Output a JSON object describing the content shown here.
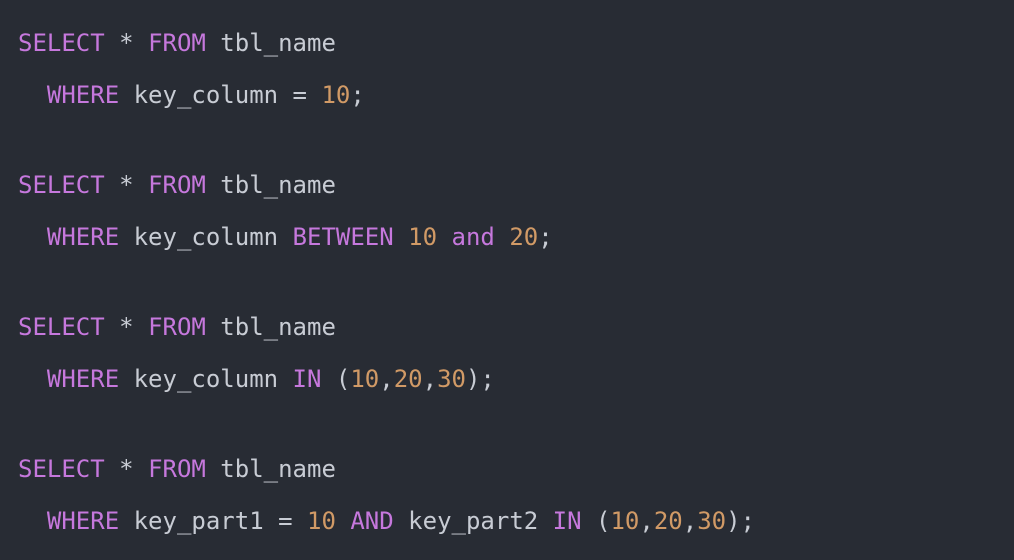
{
  "editor": {
    "background": "#282c34",
    "colors": {
      "keyword": "#c678dd",
      "number": "#d19a66",
      "plain": "#c8ccd4"
    },
    "lines": [
      [
        {
          "t": "keyword",
          "v": "SELECT"
        },
        {
          "t": "plain",
          "v": " * "
        },
        {
          "t": "keyword",
          "v": "FROM"
        },
        {
          "t": "plain",
          "v": " tbl_name"
        }
      ],
      [
        {
          "t": "plain",
          "v": "  "
        },
        {
          "t": "keyword",
          "v": "WHERE"
        },
        {
          "t": "plain",
          "v": " key_column = "
        },
        {
          "t": "number",
          "v": "10"
        },
        {
          "t": "punct",
          "v": ";"
        }
      ],
      [
        {
          "t": "keyword",
          "v": "SELECT"
        },
        {
          "t": "plain",
          "v": " * "
        },
        {
          "t": "keyword",
          "v": "FROM"
        },
        {
          "t": "plain",
          "v": " tbl_name"
        }
      ],
      [
        {
          "t": "plain",
          "v": "  "
        },
        {
          "t": "keyword",
          "v": "WHERE"
        },
        {
          "t": "plain",
          "v": " key_column "
        },
        {
          "t": "keyword",
          "v": "BETWEEN"
        },
        {
          "t": "plain",
          "v": " "
        },
        {
          "t": "number",
          "v": "10"
        },
        {
          "t": "plain",
          "v": " "
        },
        {
          "t": "keyword",
          "v": "and"
        },
        {
          "t": "plain",
          "v": " "
        },
        {
          "t": "number",
          "v": "20"
        },
        {
          "t": "punct",
          "v": ";"
        }
      ],
      [
        {
          "t": "keyword",
          "v": "SELECT"
        },
        {
          "t": "plain",
          "v": " * "
        },
        {
          "t": "keyword",
          "v": "FROM"
        },
        {
          "t": "plain",
          "v": " tbl_name"
        }
      ],
      [
        {
          "t": "plain",
          "v": "  "
        },
        {
          "t": "keyword",
          "v": "WHERE"
        },
        {
          "t": "plain",
          "v": " key_column "
        },
        {
          "t": "keyword",
          "v": "IN"
        },
        {
          "t": "plain",
          "v": " ("
        },
        {
          "t": "number",
          "v": "10"
        },
        {
          "t": "punct",
          "v": ","
        },
        {
          "t": "number",
          "v": "20"
        },
        {
          "t": "punct",
          "v": ","
        },
        {
          "t": "number",
          "v": "30"
        },
        {
          "t": "punct",
          "v": ");"
        }
      ],
      [
        {
          "t": "keyword",
          "v": "SELECT"
        },
        {
          "t": "plain",
          "v": " * "
        },
        {
          "t": "keyword",
          "v": "FROM"
        },
        {
          "t": "plain",
          "v": " tbl_name"
        }
      ],
      [
        {
          "t": "plain",
          "v": "  "
        },
        {
          "t": "keyword",
          "v": "WHERE"
        },
        {
          "t": "plain",
          "v": " key_part1 = "
        },
        {
          "t": "number",
          "v": "10"
        },
        {
          "t": "plain",
          "v": " "
        },
        {
          "t": "keyword",
          "v": "AND"
        },
        {
          "t": "plain",
          "v": " key_part2 "
        },
        {
          "t": "keyword",
          "v": "IN"
        },
        {
          "t": "plain",
          "v": " ("
        },
        {
          "t": "number",
          "v": "10"
        },
        {
          "t": "punct",
          "v": ","
        },
        {
          "t": "number",
          "v": "20"
        },
        {
          "t": "punct",
          "v": ","
        },
        {
          "t": "number",
          "v": "30"
        },
        {
          "t": "punct",
          "v": ");"
        }
      ]
    ]
  }
}
